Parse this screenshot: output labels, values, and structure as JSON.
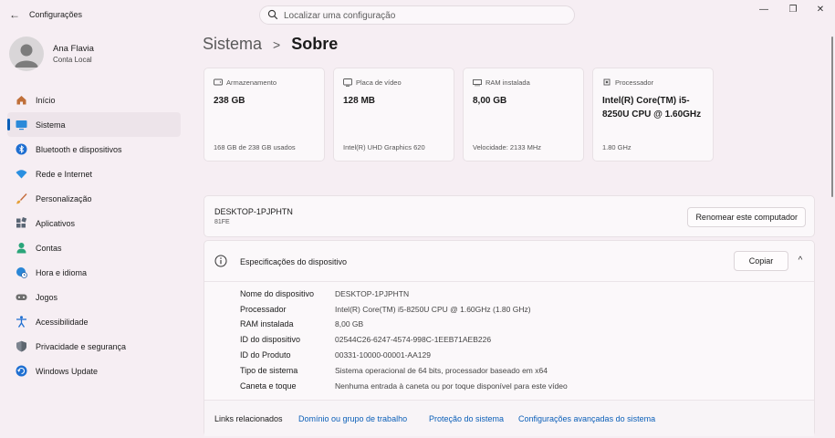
{
  "titlebar": {
    "app_title": "Configurações",
    "search_placeholder": "Localizar uma configuração"
  },
  "profile": {
    "name": "Ana Flavia",
    "account_type": "Conta Local"
  },
  "sidebar": {
    "items": [
      {
        "label": "Início",
        "icon": "home-icon"
      },
      {
        "label": "Sistema",
        "icon": "system-icon",
        "active": true
      },
      {
        "label": "Bluetooth e dispositivos",
        "icon": "bluetooth-icon"
      },
      {
        "label": "Rede e Internet",
        "icon": "wifi-icon"
      },
      {
        "label": "Personalização",
        "icon": "brush-icon"
      },
      {
        "label": "Aplicativos",
        "icon": "apps-icon"
      },
      {
        "label": "Contas",
        "icon": "person-icon"
      },
      {
        "label": "Hora e idioma",
        "icon": "globe-clock-icon"
      },
      {
        "label": "Jogos",
        "icon": "gamepad-icon"
      },
      {
        "label": "Acessibilidade",
        "icon": "accessibility-icon"
      },
      {
        "label": "Privacidade e segurança",
        "icon": "shield-icon"
      },
      {
        "label": "Windows Update",
        "icon": "update-icon"
      }
    ]
  },
  "header": {
    "parent": "Sistema",
    "separator": ">",
    "current": "Sobre"
  },
  "cards": [
    {
      "label": "Armazenamento",
      "value": "238 GB",
      "footer": "168 GB de 238 GB usados",
      "icon": "storage-icon"
    },
    {
      "label": "Placa de vídeo",
      "value": "128 MB",
      "footer": "Intel(R) UHD Graphics 620",
      "icon": "gpu-icon"
    },
    {
      "label": "RAM instalada",
      "value": "8,00 GB",
      "footer": "Velocidade: 2133 MHz",
      "icon": "ram-icon"
    },
    {
      "label": "Processador",
      "value": "Intel(R) Core(TM) i5-8250U CPU @ 1.60GHz",
      "footer": "1.80 GHz",
      "icon": "cpu-icon"
    }
  ],
  "device": {
    "name": "DESKTOP-1PJPHTN",
    "sub": "81FE",
    "rename_label": "Renomear este computador"
  },
  "specs": {
    "title": "Especificações do dispositivo",
    "copy_label": "Copiar",
    "collapse_glyph": "^",
    "rows": [
      {
        "key": "Nome do dispositivo",
        "value": "DESKTOP-1PJPHTN"
      },
      {
        "key": "Processador",
        "value": "Intel(R) Core(TM) i5-8250U CPU @ 1.60GHz (1.80 GHz)"
      },
      {
        "key": "RAM instalada",
        "value": "8,00 GB"
      },
      {
        "key": "ID do dispositivo",
        "value": "02544C26-6247-4574-998C-1EEB71AEB226"
      },
      {
        "key": "ID do Produto",
        "value": "00331-10000-00001-AA129"
      },
      {
        "key": "Tipo de sistema",
        "value": "Sistema operacional de 64 bits, processador baseado em x64"
      },
      {
        "key": "Caneta e toque",
        "value": "Nenhuma entrada à caneta ou por toque disponível para este vídeo"
      }
    ]
  },
  "links": {
    "label": "Links relacionados",
    "items": [
      "Domínio ou grupo de trabalho",
      "Proteção do sistema",
      "Configurações avançadas do sistema"
    ]
  },
  "colors": {
    "accent": "#0b5fb8",
    "background": "#f6eef3"
  }
}
